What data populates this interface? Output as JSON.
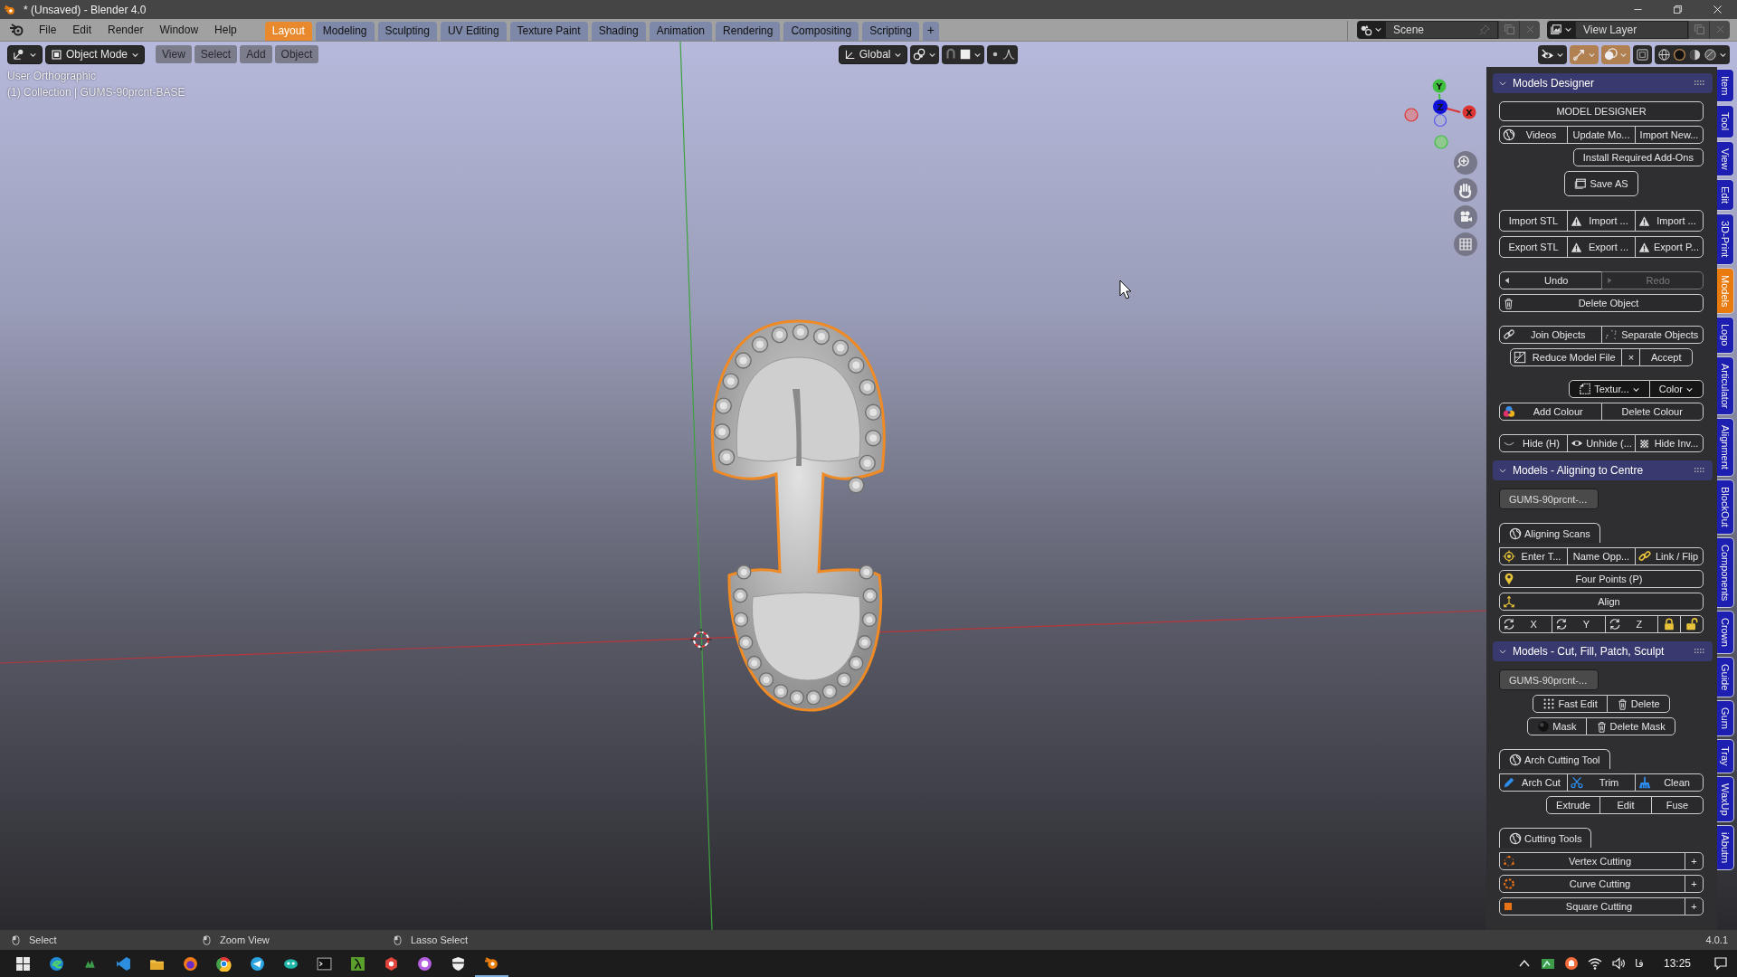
{
  "window": {
    "title": "* (Unsaved) - Blender 4.0"
  },
  "menu": [
    "File",
    "Edit",
    "Render",
    "Window",
    "Help"
  ],
  "workspaces": [
    {
      "label": "Layout",
      "selected": true
    },
    {
      "label": "Modeling",
      "selected": false
    },
    {
      "label": "Sculpting",
      "selected": false
    },
    {
      "label": "UV Editing",
      "selected": false
    },
    {
      "label": "Texture Paint",
      "selected": false
    },
    {
      "label": "Shading",
      "selected": false
    },
    {
      "label": "Animation",
      "selected": false
    },
    {
      "label": "Rendering",
      "selected": false
    },
    {
      "label": "Compositing",
      "selected": false
    },
    {
      "label": "Scripting",
      "selected": false
    }
  ],
  "add_workspace": "+",
  "scene": {
    "scene": "Scene",
    "view_layer": "View Layer"
  },
  "header": {
    "mode": "Object Mode",
    "menus": [
      "View",
      "Select",
      "Add",
      "Object"
    ],
    "orientation": "Global"
  },
  "viewport": {
    "view": "User Orthographic",
    "object": "(1) Collection | GUMS-90prcnt-BASE",
    "axes": [
      "Y",
      "Z",
      "X"
    ]
  },
  "panels": [
    {
      "title": "Models Designer",
      "expanded": true,
      "groups": [
        [
          {
            "items": [
              {
                "kind": "button",
                "label": "MODEL DESIGNER"
              }
            ]
          },
          {
            "items": [
              {
                "kind": "button",
                "label": "Videos"
              },
              {
                "kind": "button",
                "label": "Update Mo..."
              },
              {
                "kind": "button",
                "label": "Import New..."
              }
            ]
          },
          {
            "items": [
              {
                "kind": "button",
                "label": "Install Required Add-Ons"
              }
            ]
          },
          {
            "items": [
              {
                "kind": "button",
                "label": "Save AS"
              }
            ]
          }
        ],
        [
          {
            "items": [
              {
                "kind": "button",
                "label": "Import STL"
              },
              {
                "kind": "button",
                "label": "Import ..."
              },
              {
                "kind": "button",
                "label": "Import ..."
              }
            ]
          },
          {
            "items": [
              {
                "kind": "button",
                "label": "Export STL"
              },
              {
                "kind": "button",
                "label": "Export ..."
              },
              {
                "kind": "button",
                "label": "Export P..."
              }
            ]
          }
        ],
        [
          {
            "items": [
              {
                "kind": "button",
                "label": "Undo",
                "disabled": false
              },
              {
                "kind": "button",
                "label": "Redo",
                "disabled": true
              }
            ]
          },
          {
            "items": [
              {
                "kind": "button",
                "label": "Delete Object"
              }
            ]
          }
        ],
        [
          {
            "items": [
              {
                "kind": "button",
                "label": "Join Objects"
              },
              {
                "kind": "button",
                "label": "Separate Objects"
              }
            ]
          },
          {
            "items": [
              {
                "kind": "button",
                "label": "Reduce Model File"
              },
              {
                "kind": "mini",
                "label": "×"
              },
              {
                "kind": "button",
                "label": "Accept"
              }
            ]
          }
        ],
        [
          {
            "items": [
              {
                "kind": "dropdown",
                "label": "Textur..."
              },
              {
                "kind": "dropdown",
                "label": "Color"
              }
            ]
          },
          {
            "items": [
              {
                "kind": "button",
                "label": "Add Colour"
              },
              {
                "kind": "button",
                "label": "Delete Colour"
              }
            ]
          }
        ],
        [
          {
            "items": [
              {
                "kind": "button",
                "label": "Hide (H)"
              },
              {
                "kind": "button",
                "label": "Unhide (..."
              },
              {
                "kind": "button",
                "label": "Hide Inv..."
              }
            ]
          }
        ]
      ]
    },
    {
      "title": "Models - Aligning to Centre",
      "expanded": true,
      "groups": [
        [
          {
            "items": [
              {
                "kind": "field",
                "label": "GUMS-90prcnt-..."
              }
            ]
          }
        ],
        [
          {
            "items": [
              {
                "kind": "box-title",
                "label": "Aligning Scans"
              }
            ]
          },
          {
            "items": [
              {
                "kind": "button",
                "label": "Enter T..."
              },
              {
                "kind": "button",
                "label": "Name Opp..."
              },
              {
                "kind": "button",
                "label": "Link / Flip"
              }
            ]
          },
          {
            "items": [
              {
                "kind": "button",
                "label": "Four Points (P)"
              }
            ]
          },
          {
            "items": [
              {
                "kind": "button",
                "label": "Align"
              }
            ]
          },
          {
            "items": [
              {
                "kind": "button",
                "label": "X"
              },
              {
                "kind": "button",
                "label": "Y"
              },
              {
                "kind": "button",
                "label": "Z"
              },
              {
                "kind": "lock",
                "locked": true
              },
              {
                "kind": "lock",
                "locked": false
              }
            ]
          }
        ]
      ]
    },
    {
      "title": "Models - Cut, Fill, Patch, Sculpt",
      "expanded": true,
      "groups": [
        [
          {
            "items": [
              {
                "kind": "field",
                "label": "GUMS-90prcnt-..."
              }
            ]
          },
          {
            "items": [
              {
                "kind": "button",
                "label": "Fast Edit"
              },
              {
                "kind": "button",
                "label": "Delete"
              }
            ]
          },
          {
            "items": [
              {
                "kind": "button",
                "label": "Mask"
              },
              {
                "kind": "button",
                "label": "Delete Mask"
              }
            ]
          }
        ],
        [
          {
            "items": [
              {
                "kind": "box-title",
                "label": "Arch Cutting Tool"
              }
            ]
          },
          {
            "items": [
              {
                "kind": "button",
                "label": "Arch Cut"
              },
              {
                "kind": "button",
                "label": "Trim"
              },
              {
                "kind": "button",
                "label": "Clean"
              }
            ]
          },
          {
            "items": [
              {
                "kind": "button",
                "label": "Extrude"
              },
              {
                "kind": "button",
                "label": "Edit"
              },
              {
                "kind": "button",
                "label": "Fuse"
              }
            ]
          }
        ],
        [
          {
            "items": [
              {
                "kind": "box-title",
                "label": "Cutting Tools"
              }
            ]
          },
          {
            "items": [
              {
                "kind": "button",
                "label": "Vertex Cutting"
              },
              {
                "kind": "mini",
                "label": "+"
              }
            ]
          },
          {
            "items": [
              {
                "kind": "button",
                "label": "Curve Cutting"
              },
              {
                "kind": "mini",
                "label": "+"
              }
            ]
          },
          {
            "items": [
              {
                "kind": "button",
                "label": "Square Cutting"
              },
              {
                "kind": "mini",
                "label": "+"
              }
            ]
          }
        ]
      ]
    }
  ],
  "tabs": [
    {
      "label": "Item",
      "selected": false
    },
    {
      "label": "Tool",
      "selected": false
    },
    {
      "label": "View",
      "selected": false
    },
    {
      "label": "Edit",
      "selected": false
    },
    {
      "label": "3D-Print",
      "selected": false
    },
    {
      "label": "Models",
      "selected": true
    },
    {
      "label": "Logo",
      "selected": false
    },
    {
      "label": "Articulator",
      "selected": false
    },
    {
      "label": "Alignment",
      "selected": false
    },
    {
      "label": "BlockOut",
      "selected": false
    },
    {
      "label": "Components",
      "selected": false
    },
    {
      "label": "Crown",
      "selected": false
    },
    {
      "label": "Guide",
      "selected": false
    },
    {
      "label": "Gum",
      "selected": false
    },
    {
      "label": "Tray",
      "selected": false
    },
    {
      "label": "WaxUp",
      "selected": false
    },
    {
      "label": "iAbutm",
      "selected": false
    }
  ],
  "status": {
    "hints": [
      "Select",
      "Zoom View",
      "Lasso Select"
    ],
    "version": "4.0.1"
  },
  "taskbar": {
    "language": "فا",
    "time": "13:25"
  }
}
